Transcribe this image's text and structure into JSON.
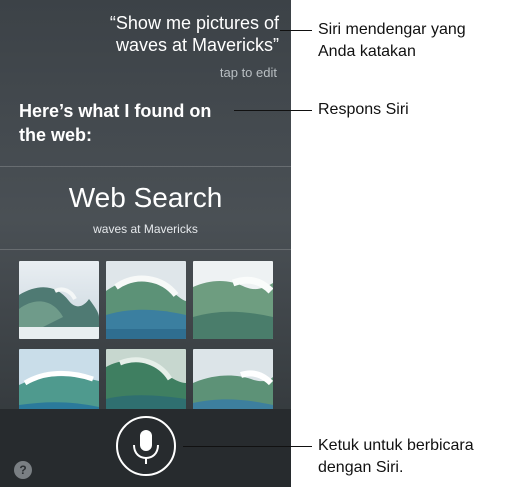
{
  "siri": {
    "query_line1": "“Show me pictures of",
    "query_line2": "waves at Mavericks”",
    "tap_to_edit": "tap to edit",
    "response_line1": "Here’s what I found on",
    "response_line2": "the web:",
    "web_search_title": "Web Search",
    "web_search_query": "waves at Mavericks",
    "help_label": "?"
  },
  "callouts": {
    "heard_line1": "Siri mendengar yang",
    "heard_line2": "Anda katakan",
    "response": "Respons Siri",
    "tap_line1": "Ketuk untuk berbicara",
    "tap_line2": "dengan Siri."
  },
  "icons": {
    "mic": "microphone-icon",
    "help": "question-mark-icon"
  },
  "colors": {
    "screen_bg": "#42484d",
    "bottom_bar": "#272b2e"
  }
}
